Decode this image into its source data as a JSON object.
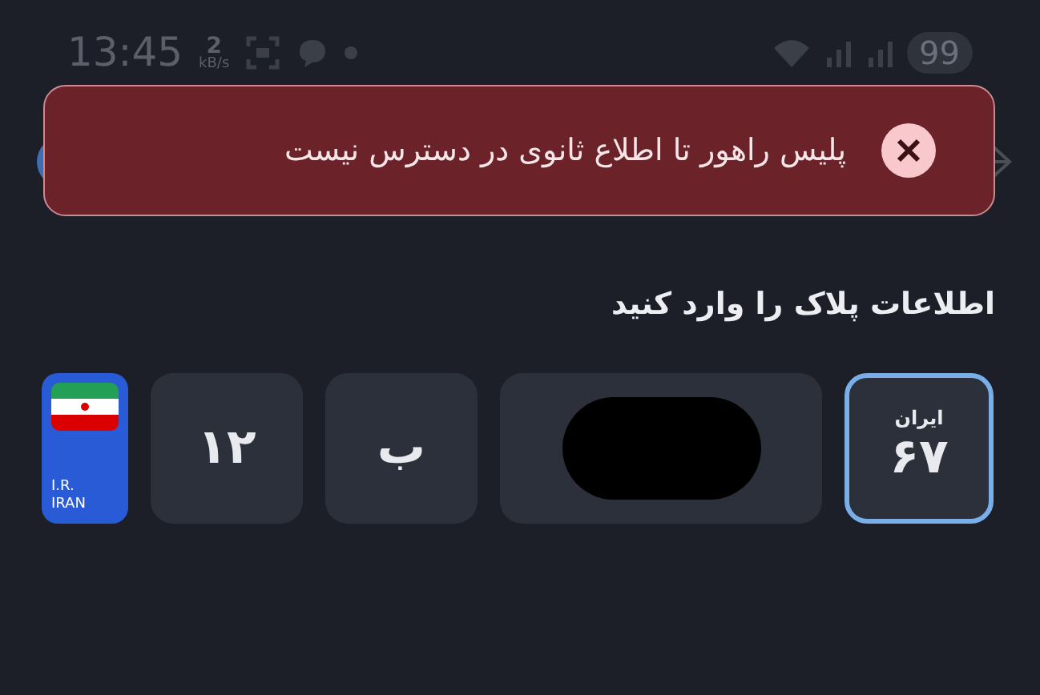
{
  "status_bar": {
    "time": "13:45",
    "speed_value": "2",
    "speed_unit": "kB/s",
    "battery": "99"
  },
  "toast": {
    "message": "پلیس راهور تا اطلاع ثانوی در دسترس نیست"
  },
  "heading": "اطلاعات پلاک را وارد کنید",
  "plate": {
    "country_lines": [
      "I.R.",
      "IRAN"
    ],
    "fields": [
      {
        "kind": "region",
        "caption": "ایران",
        "value": "۶۷",
        "selected": true
      },
      {
        "kind": "redacted",
        "selected": false
      },
      {
        "kind": "text",
        "value": "ب",
        "selected": false
      },
      {
        "kind": "text",
        "value": "۱۲",
        "selected": false
      }
    ]
  }
}
